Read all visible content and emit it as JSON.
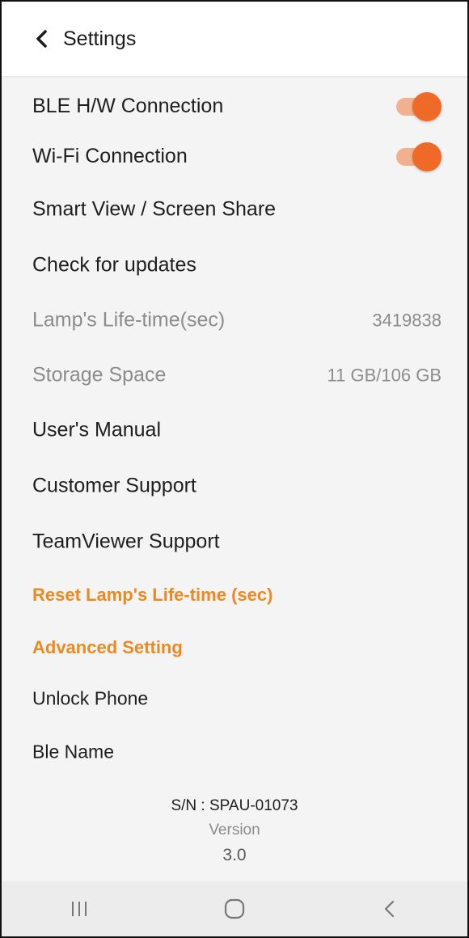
{
  "header": {
    "title": "Settings",
    "back_icon": "chevron-left-icon"
  },
  "colors": {
    "accent": "#ec8a22",
    "toggle_on": "#ee6a26",
    "toggle_track": "#f2b18e"
  },
  "settings": {
    "ble": {
      "label": "BLE H/W Connection",
      "enabled": true
    },
    "wifi": {
      "label": "Wi-Fi Connection",
      "enabled": true
    },
    "smart_view": {
      "label": "Smart View / Screen Share"
    },
    "updates": {
      "label": "Check for updates"
    },
    "lamp_life": {
      "label": "Lamp's Life-time(sec)",
      "value": "3419838"
    },
    "storage": {
      "label": "Storage Space",
      "value": "11 GB/106 GB"
    },
    "manual": {
      "label": "User's Manual"
    },
    "customer_support": {
      "label": "Customer Support"
    },
    "teamviewer": {
      "label": "TeamViewer Support"
    },
    "reset_lamp": {
      "label": "Reset Lamp's Life-time (sec)"
    },
    "advanced": {
      "label": "Advanced Setting"
    },
    "unlock_phone": {
      "label": "Unlock Phone"
    },
    "ble_name": {
      "label": "Ble Name"
    }
  },
  "footer": {
    "serial": "S/N : SPAU-01073",
    "version_label": "Version",
    "version": "3.0"
  },
  "navbar": {
    "icons": [
      "recent-apps-icon",
      "home-icon",
      "back-icon"
    ]
  }
}
